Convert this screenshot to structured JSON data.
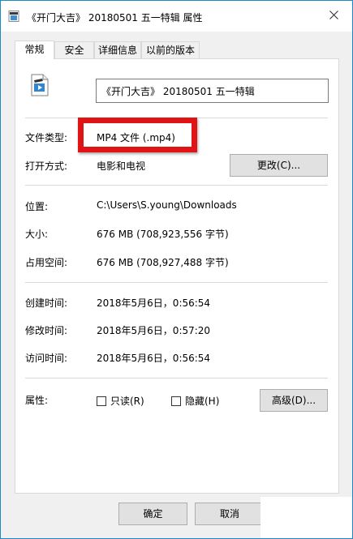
{
  "window": {
    "title": "《开门大吉》 20180501 五一特辑 属性",
    "close_icon": "close-icon"
  },
  "tabs": [
    {
      "label": "常规",
      "active": true
    },
    {
      "label": "安全",
      "active": false
    },
    {
      "label": "详细信息",
      "active": false
    },
    {
      "label": "以前的版本",
      "active": false
    }
  ],
  "general": {
    "file_icon": "video-file-icon",
    "file_name": "《开门大吉》 20180501 五一特辑",
    "type_label": "文件类型:",
    "type_value": "MP4 文件 (.mp4)",
    "open_with_label": "打开方式:",
    "open_with_value": "电影和电视",
    "change_button": "更改(C)...",
    "location_label": "位置:",
    "location_value": "C:\\Users\\S.young\\Downloads",
    "size_label": "大小:",
    "size_value": "676 MB (708,923,556 字节)",
    "disk_size_label": "占用空间:",
    "disk_size_value": "676 MB (708,927,488 字节)",
    "created_label": "创建时间:",
    "created_value": "2018年5月6日，0:56:54",
    "modified_label": "修改时间:",
    "modified_value": "2018年5月6日，0:57:20",
    "accessed_label": "访问时间:",
    "accessed_value": "2018年5月6日，0:56:54",
    "attributes_label": "属性:",
    "readonly_label": "只读(R)",
    "hidden_label": "隐藏(H)",
    "advanced_button": "高级(D)..."
  },
  "footer": {
    "ok_button": "确定",
    "cancel_button": "取消"
  },
  "colors": {
    "highlight": "#e01414",
    "window_border": "#1e87c9"
  }
}
